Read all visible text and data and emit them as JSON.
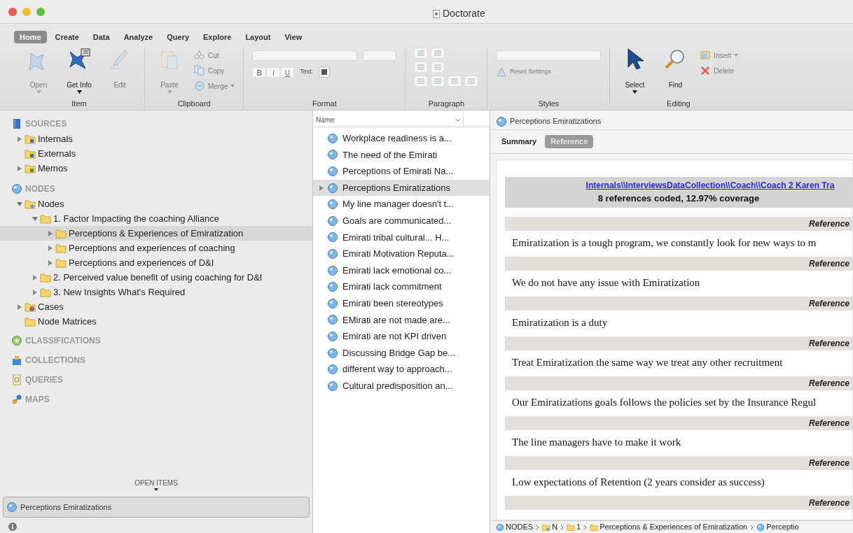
{
  "window": {
    "title": "Doctorate"
  },
  "ribbon": {
    "tabs": [
      {
        "label": "Home",
        "selected": true
      },
      {
        "label": "Create",
        "selected": false
      },
      {
        "label": "Data",
        "selected": false
      },
      {
        "label": "Analyze",
        "selected": false
      },
      {
        "label": "Query",
        "selected": false
      },
      {
        "label": "Explore",
        "selected": false
      },
      {
        "label": "Layout",
        "selected": false
      },
      {
        "label": "View",
        "selected": false
      }
    ],
    "groups": [
      {
        "label": "Item",
        "items": [
          {
            "kind": "large",
            "label": "Open",
            "disabled": true,
            "menu": true
          },
          {
            "kind": "large",
            "label": "Get Info",
            "disabled": false,
            "menu": true
          },
          {
            "kind": "large",
            "label": "Edit",
            "disabled": true,
            "menu": false
          }
        ]
      },
      {
        "label": "Clipboard",
        "items": [
          {
            "kind": "large",
            "label": "Paste",
            "disabled": true,
            "menu": true
          },
          {
            "kind": "small",
            "label": "Cut",
            "disabled": true,
            "menu": false
          },
          {
            "kind": "small",
            "label": "Copy",
            "disabled": true,
            "menu": false
          },
          {
            "kind": "small",
            "label": "Merge",
            "disabled": true,
            "menu": true
          }
        ]
      },
      {
        "label": "Format",
        "items": [
          {
            "kind": "format",
            "styles": [
              "B",
              "I",
              "U"
            ],
            "text_label": "Text:"
          }
        ]
      },
      {
        "label": "Paragraph",
        "items": [
          {
            "kind": "paragraph"
          }
        ]
      },
      {
        "label": "Styles",
        "items": [
          {
            "kind": "styles",
            "action": "Reset Settings",
            "disabled": true
          }
        ]
      },
      {
        "label": "Editing",
        "items": [
          {
            "kind": "large",
            "label": "Select",
            "disabled": false,
            "menu": true
          },
          {
            "kind": "large",
            "label": "Find",
            "disabled": false,
            "menu": false
          },
          {
            "kind": "stack",
            "entries": [
              {
                "label": "Insert",
                "disabled": true,
                "menu": true
              },
              {
                "label": "Delete",
                "disabled": true,
                "menu": false
              }
            ]
          }
        ]
      }
    ]
  },
  "sidebar": {
    "sections": [
      {
        "label": "SOURCES",
        "items": [
          {
            "label": "Internals",
            "kind": "source-folder",
            "expandable": true,
            "expanded": false,
            "selected": false
          },
          {
            "label": "Externals",
            "kind": "source-folder",
            "expandable": false,
            "selected": false
          },
          {
            "label": "Memos",
            "kind": "memo-folder",
            "expandable": true,
            "expanded": false,
            "selected": false
          }
        ]
      },
      {
        "label": "NODES",
        "items": [
          {
            "label": "Nodes",
            "kind": "node-folder",
            "expandable": true,
            "expanded": true,
            "selected": false,
            "children": [
              {
                "label": "1. Factor Impacting the coaching Alliance",
                "kind": "folder",
                "expandable": true,
                "expanded": true,
                "selected": false,
                "children": [
                  {
                    "label": "Perceptions & Experiences of Emiratization",
                    "kind": "folder",
                    "expandable": true,
                    "expanded": false,
                    "selected": true
                  },
                  {
                    "label": "Perceptions and experiences of coaching",
                    "kind": "folder",
                    "expandable": true,
                    "expanded": false,
                    "selected": false
                  },
                  {
                    "label": "Perceptions and experiences of D&I",
                    "kind": "folder",
                    "expandable": true,
                    "expanded": false,
                    "selected": false
                  }
                ]
              },
              {
                "label": "2. Perceived value benefit of using coaching for D&I",
                "kind": "folder",
                "expandable": true,
                "expanded": false,
                "selected": false
              },
              {
                "label": "3. New Insights What's Required",
                "kind": "folder",
                "expandable": true,
                "expanded": false,
                "selected": false
              }
            ]
          },
          {
            "label": "Cases",
            "kind": "case-folder",
            "expandable": true,
            "expanded": false,
            "selected": false
          },
          {
            "label": "Node Matrices",
            "kind": "folder",
            "expandable": false,
            "selected": false
          }
        ]
      },
      {
        "label": "CLASSIFICATIONS"
      },
      {
        "label": "COLLECTIONS"
      },
      {
        "label": "QUERIES"
      },
      {
        "label": "MAPS"
      }
    ],
    "open_items": {
      "label": "OPEN ITEMS",
      "items": [
        {
          "label": "Perceptions Emiratizations",
          "selected": true
        }
      ]
    }
  },
  "list": {
    "columns": [
      "Name"
    ],
    "rows": [
      {
        "label": "Workplace readiness is a...",
        "expandable": false,
        "selected": false
      },
      {
        "label": "The need of the Emirati",
        "expandable": false,
        "selected": false
      },
      {
        "label": "Perceptions of Emirati Na...",
        "expandable": false,
        "selected": false
      },
      {
        "label": "Perceptions Emiratizations",
        "expandable": true,
        "selected": true
      },
      {
        "label": "My line manager doesn't t...",
        "expandable": false,
        "selected": false
      },
      {
        "label": "Goals are communicated...",
        "expandable": false,
        "selected": false
      },
      {
        "label": "Emirati tribal cultural... H...",
        "expandable": false,
        "selected": false
      },
      {
        "label": "Emirati Motivation Reputa...",
        "expandable": false,
        "selected": false
      },
      {
        "label": "Emirati lack emotional co...",
        "expandable": false,
        "selected": false
      },
      {
        "label": "Emirati lack commitment",
        "expandable": false,
        "selected": false
      },
      {
        "label": "Emirati been stereotypes",
        "expandable": false,
        "selected": false
      },
      {
        "label": "EMirati are not made are...",
        "expandable": false,
        "selected": false
      },
      {
        "label": "Emirati are not KPI driven",
        "expandable": false,
        "selected": false
      },
      {
        "label": "Discussing Bridge Gap be...",
        "expandable": false,
        "selected": false
      },
      {
        "label": "different way to approach...",
        "expandable": false,
        "selected": false
      },
      {
        "label": "Cultural predisposition an...",
        "expandable": false,
        "selected": false
      }
    ]
  },
  "detail": {
    "title": "Perceptions Emiratizations",
    "tabs": [
      {
        "label": "Summary",
        "selected": false
      },
      {
        "label": "Reference",
        "selected": true
      }
    ],
    "source_link": "Internals\\\\InterviewsDataCollection\\\\Coach\\\\Coach 2 Karen Tra",
    "coverage": "8 references coded, 12.97% coverage",
    "references": [
      {
        "heading": "Reference",
        "text": "Emiratization is a tough program, we constantly look for new ways to m"
      },
      {
        "heading": "Reference",
        "text": "We do not have any issue with Emiratization"
      },
      {
        "heading": "Reference",
        "text": "Emiratization is a duty"
      },
      {
        "heading": "Reference",
        "text": "Treat Emiratization the same way we treat any other recruitment"
      },
      {
        "heading": "Reference",
        "text": "Our Emiratizations goals follows the policies set by the Insurance Regul"
      },
      {
        "heading": "Reference",
        "text": "The line managers have to make it work"
      },
      {
        "heading": "Reference",
        "text": "Low expectations of Retention (2 years consider as success)"
      },
      {
        "heading": "Reference"
      }
    ],
    "breadcrumb": [
      {
        "label": "NODES",
        "kind": "node"
      },
      {
        "label": "N",
        "kind": "node-folder"
      },
      {
        "label": "1",
        "kind": "folder"
      },
      {
        "label": "Perceptions & Experiences of Emiratization",
        "kind": "folder"
      },
      {
        "label": "Perceptio",
        "kind": "node"
      }
    ]
  }
}
